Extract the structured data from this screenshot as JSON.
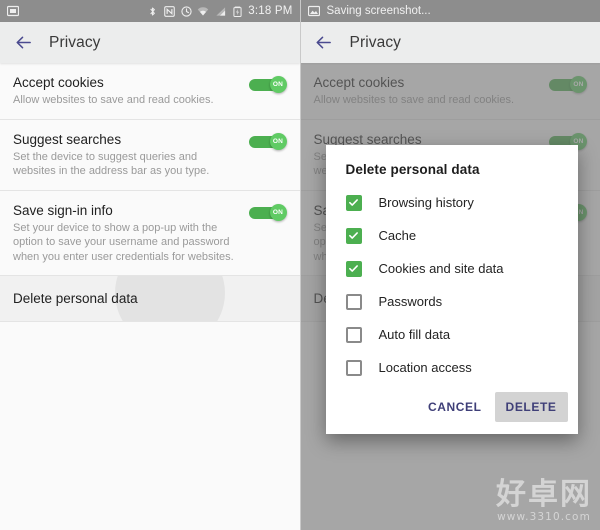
{
  "left": {
    "statusbar": {
      "left_icons": [
        "screenshot-icon"
      ],
      "icons": [
        "bluetooth-icon",
        "nfc-icon",
        "alarm-icon",
        "wifi-icon",
        "signal-icon",
        "battery-charging-icon"
      ],
      "clock": "3:18 PM"
    },
    "appbar": {
      "title": "Privacy",
      "back_icon": "back-arrow-icon"
    },
    "items": [
      {
        "title": "Accept cookies",
        "subtitle": "Allow websites to save and read cookies.",
        "toggle": "ON",
        "type": "switch"
      },
      {
        "title": "Suggest searches",
        "subtitle": "Set the device to suggest queries and websites in the address bar as you type.",
        "toggle": "ON",
        "type": "switch"
      },
      {
        "title": "Save sign-in info",
        "subtitle": "Set your device to show a pop-up with the option to save your username and password when you enter user credentials for websites.",
        "toggle": "ON",
        "type": "switch"
      },
      {
        "title": "Delete personal data",
        "subtitle": "",
        "toggle": "",
        "type": "action"
      }
    ]
  },
  "right": {
    "statusbar": {
      "message": "Saving screenshot...",
      "icon": "screenshot-image-icon"
    },
    "appbar": {
      "title": "Privacy",
      "back_icon": "back-arrow-icon"
    },
    "dialog": {
      "title": "Delete personal data",
      "options": [
        {
          "label": "Browsing history",
          "checked": true
        },
        {
          "label": "Cache",
          "checked": true
        },
        {
          "label": "Cookies and site data",
          "checked": true
        },
        {
          "label": "Passwords",
          "checked": false
        },
        {
          "label": "Auto fill data",
          "checked": false
        },
        {
          "label": "Location access",
          "checked": false
        }
      ],
      "cancel_label": "CANCEL",
      "confirm_label": "DELETE"
    }
  },
  "watermark": {
    "cn": "好卓网",
    "url": "www.3310.com"
  },
  "colors": {
    "toggle_on": "#4caf50",
    "checkbox_checked": "#4caf50",
    "accent": "#4a4a8f",
    "statusbar": "#8d8d8d",
    "appbar": "#eceded"
  }
}
